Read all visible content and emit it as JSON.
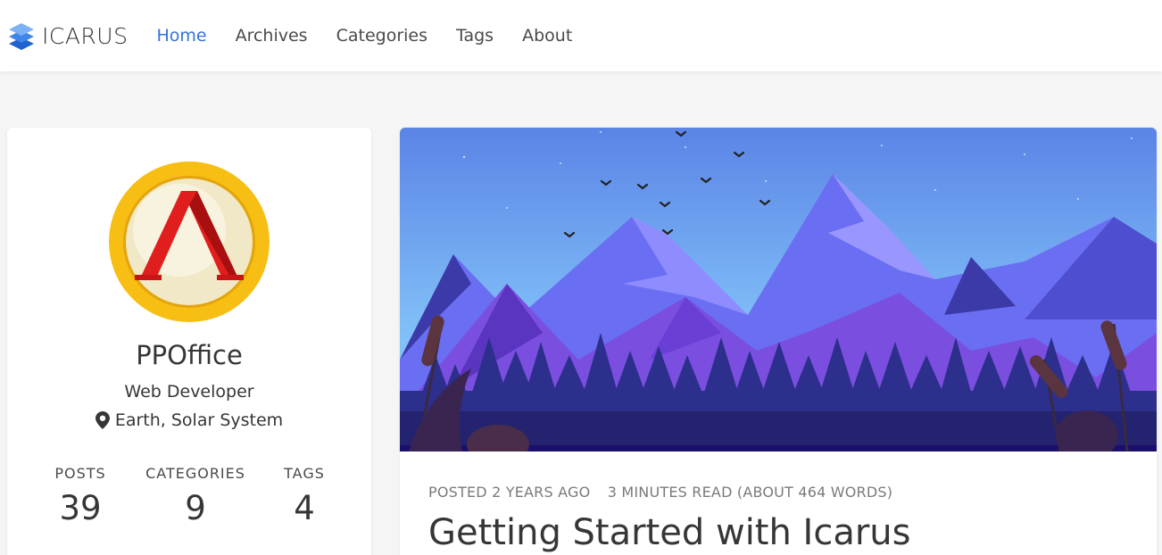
{
  "navbar": {
    "brand": "ICARUS",
    "items": [
      {
        "label": "Home",
        "active": true
      },
      {
        "label": "Archives",
        "active": false
      },
      {
        "label": "Categories",
        "active": false
      },
      {
        "label": "Tags",
        "active": false
      },
      {
        "label": "About",
        "active": false
      }
    ]
  },
  "profile": {
    "name": "PPOffice",
    "title": "Web Developer",
    "location": "Earth, Solar System",
    "stats": [
      {
        "label": "POSTS",
        "value": "39"
      },
      {
        "label": "CATEGORIES",
        "value": "9"
      },
      {
        "label": "TAGS",
        "value": "4"
      }
    ]
  },
  "post": {
    "posted": "POSTED 2 YEARS AGO",
    "read_time": "3 MINUTES READ (ABOUT 464 WORDS)",
    "title": "Getting Started with Icarus"
  },
  "colors": {
    "accent": "#3273dc",
    "background": "#f5f5f5"
  }
}
